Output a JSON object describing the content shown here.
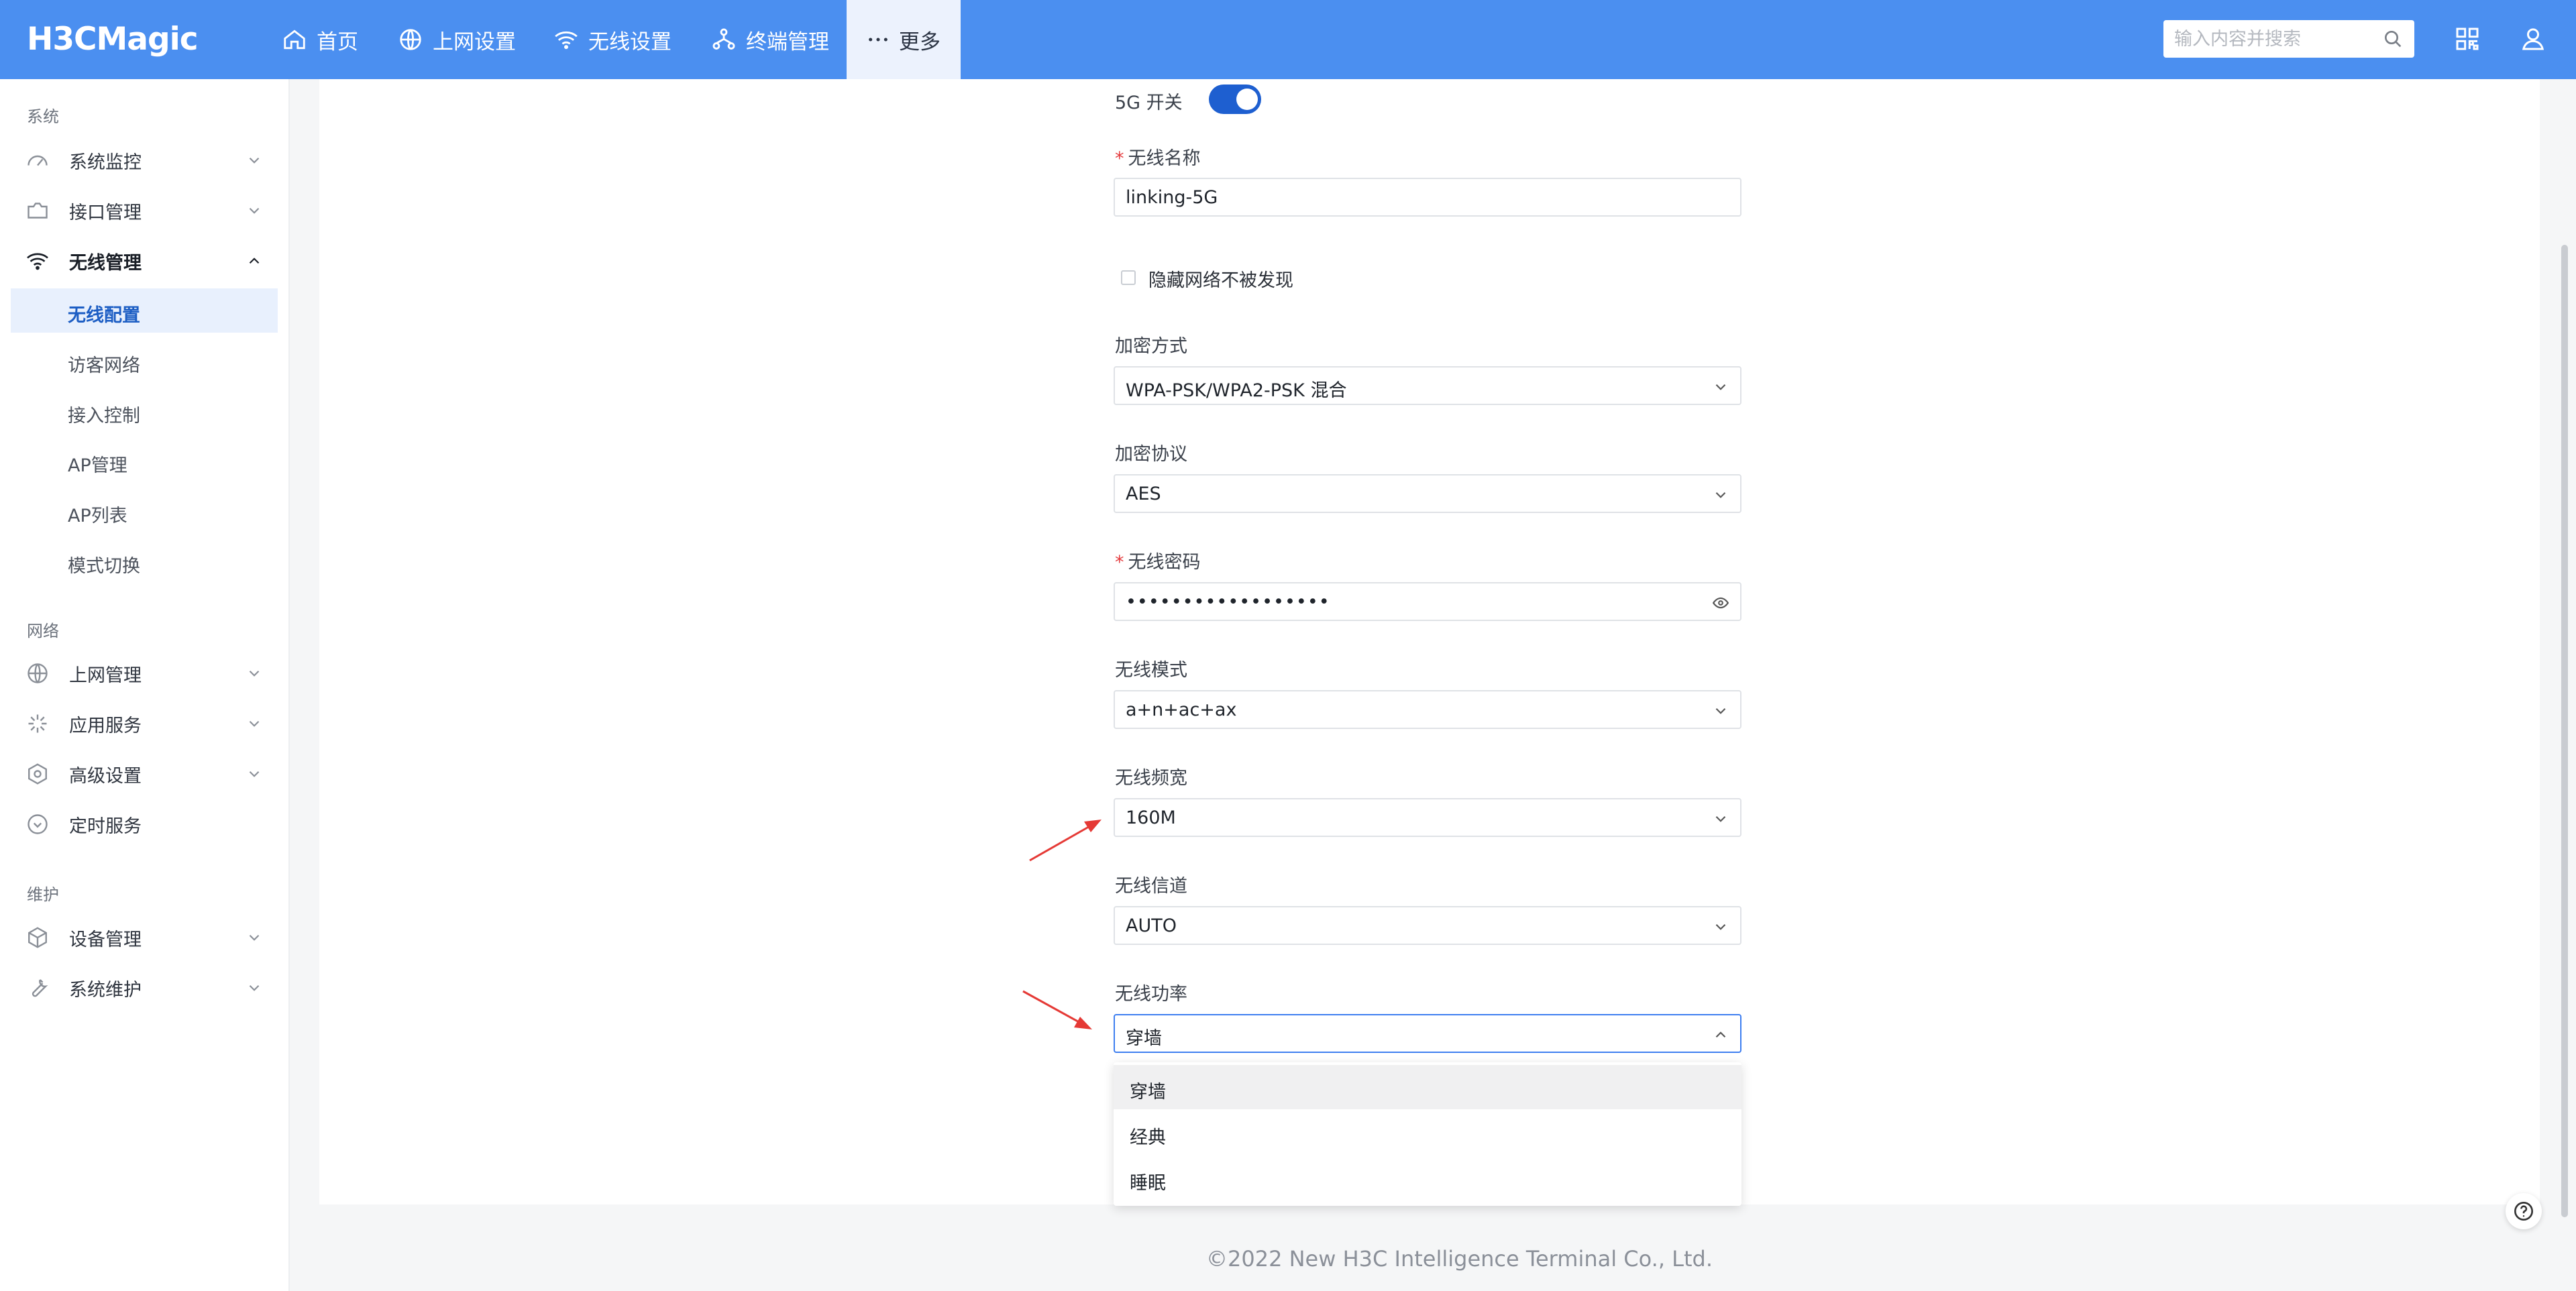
{
  "brand": "H3CMagic",
  "nav": {
    "items": [
      {
        "label": "首页"
      },
      {
        "label": "上网设置"
      },
      {
        "label": "无线设置"
      },
      {
        "label": "终端管理"
      },
      {
        "label": "更多"
      }
    ]
  },
  "search": {
    "placeholder": "输入内容并搜索"
  },
  "sidebar": {
    "sections": [
      {
        "title": "系统"
      },
      {
        "title": "网络"
      },
      {
        "title": "维护"
      }
    ],
    "items": [
      {
        "label": "系统监控"
      },
      {
        "label": "接口管理"
      },
      {
        "label": "无线管理"
      },
      {
        "label": "上网管理"
      },
      {
        "label": "应用服务"
      },
      {
        "label": "高级设置"
      },
      {
        "label": "定时服务"
      },
      {
        "label": "设备管理"
      },
      {
        "label": "系统维护"
      }
    ],
    "subitems": [
      {
        "label": "无线配置"
      },
      {
        "label": "访客网络"
      },
      {
        "label": "接入控制"
      },
      {
        "label": "AP管理"
      },
      {
        "label": "AP列表"
      },
      {
        "label": "模式切换"
      }
    ]
  },
  "form": {
    "toggle_label": "5G 开关",
    "required_mark": "*",
    "ssid_label": "无线名称",
    "ssid_value": "linking-5G",
    "hide_label": "隐藏网络不被发现",
    "enc_label": "加密方式",
    "enc_value": "WPA-PSK/WPA2-PSK 混合",
    "proto_label": "加密协议",
    "proto_value": "AES",
    "pwd_label": "无线密码",
    "pwd_value": "••••••••••••••••••",
    "mode_label": "无线模式",
    "mode_value": "a+n+ac+ax",
    "bw_label": "无线频宽",
    "bw_value": "160M",
    "channel_label": "无线信道",
    "channel_value": "AUTO",
    "power_label": "无线功率",
    "power_value": "穿墙",
    "power_options": [
      "穿墙",
      "经典",
      "睡眠"
    ]
  },
  "footer": "©2022 New H3C Intelligence Terminal Co., Ltd.",
  "colors": {
    "topbar": "#4b8ff0",
    "accent": "#1e5fd0",
    "annotation": "#e53935"
  }
}
